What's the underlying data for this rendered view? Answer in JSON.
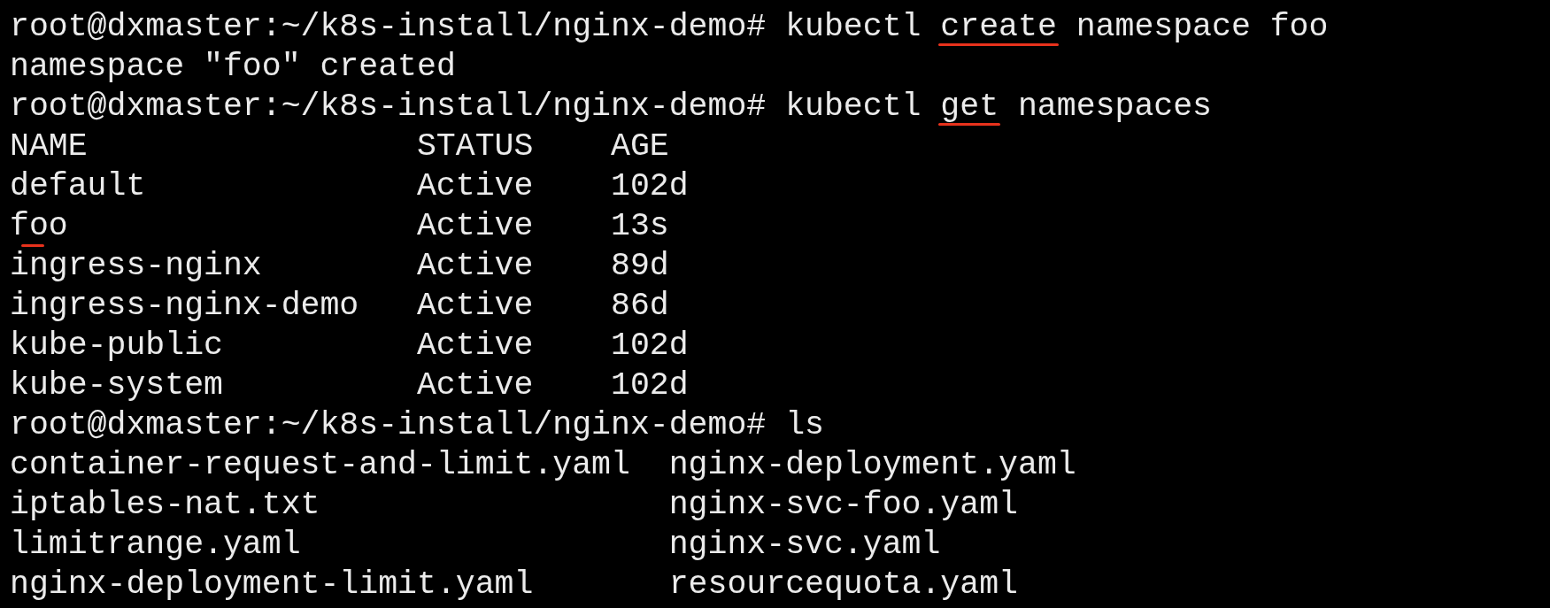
{
  "terminal": {
    "lines": [
      {
        "kind": "command",
        "prompt": "root@dxmaster:~/k8s-install/nginx-demo#",
        "words": [
          {
            "text": "kubectl",
            "underlined": false
          },
          {
            "text": "create",
            "underlined": true
          },
          {
            "text": "namespace",
            "underlined": false
          },
          {
            "text": "foo",
            "underlined": false
          }
        ]
      },
      {
        "kind": "output",
        "text": "namespace \"foo\" created"
      },
      {
        "kind": "command",
        "prompt": "root@dxmaster:~/k8s-install/nginx-demo#",
        "words": [
          {
            "text": "kubectl",
            "underlined": false
          },
          {
            "text": "get",
            "underlined": true
          },
          {
            "text": "namespaces",
            "underlined": false
          }
        ]
      },
      {
        "kind": "table",
        "columns": [
          "NAME",
          "STATUS",
          "AGE"
        ],
        "rows": [
          {
            "name": "default",
            "status": "Active",
            "age": "102d",
            "underlined": false
          },
          {
            "name": "foo",
            "status": "Active",
            "age": "13s",
            "underlined": true
          },
          {
            "name": "ingress-nginx",
            "status": "Active",
            "age": "89d",
            "underlined": false
          },
          {
            "name": "ingress-nginx-demo",
            "status": "Active",
            "age": "86d",
            "underlined": false
          },
          {
            "name": "kube-public",
            "status": "Active",
            "age": "102d",
            "underlined": false
          },
          {
            "name": "kube-system",
            "status": "Active",
            "age": "102d",
            "underlined": false
          }
        ]
      },
      {
        "kind": "command",
        "prompt": "root@dxmaster:~/k8s-install/nginx-demo#",
        "words": [
          {
            "text": "ls",
            "underlined": false
          }
        ]
      },
      {
        "kind": "files",
        "rows": [
          [
            "container-request-and-limit.yaml",
            "nginx-deployment.yaml"
          ],
          [
            "iptables-nat.txt",
            "nginx-svc-foo.yaml"
          ],
          [
            "limitrange.yaml",
            "nginx-svc.yaml"
          ],
          [
            "nginx-deployment-limit.yaml",
            "resourcequota.yaml"
          ]
        ]
      }
    ]
  }
}
